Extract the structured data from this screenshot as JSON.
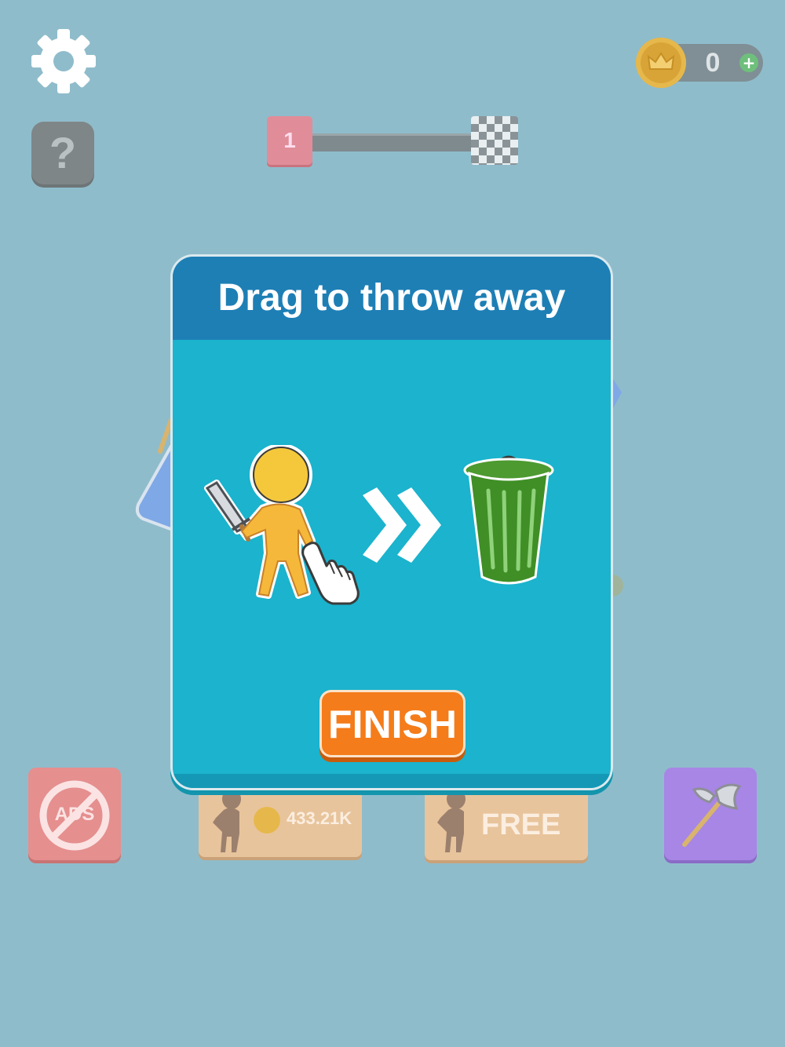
{
  "hud": {
    "settings_icon": "gear-icon",
    "help_label": "?",
    "coins": "0",
    "coin_plus": "+"
  },
  "level": {
    "current": "1",
    "finish_icon": "checkered-flag-icon"
  },
  "tutorial": {
    "title": "Drag to throw away",
    "finish_label": "FINISH",
    "illustration": [
      "character-with-sword",
      "tap-hand-icon",
      "double-chevron-right-icon",
      "trash-can-icon"
    ]
  },
  "bottom_bar": {
    "no_ads_label": "ADS",
    "buy_price": "433.21K",
    "free_label": "FREE",
    "weapon_icon": "axe-icon"
  },
  "colors": {
    "background": "#8fbccb",
    "modal_body": "#1bb3cd",
    "modal_header": "#1e7fb5",
    "finish_button": "#f47c1a",
    "character": "#f5b83a",
    "trash_can": "#3f8f26"
  }
}
